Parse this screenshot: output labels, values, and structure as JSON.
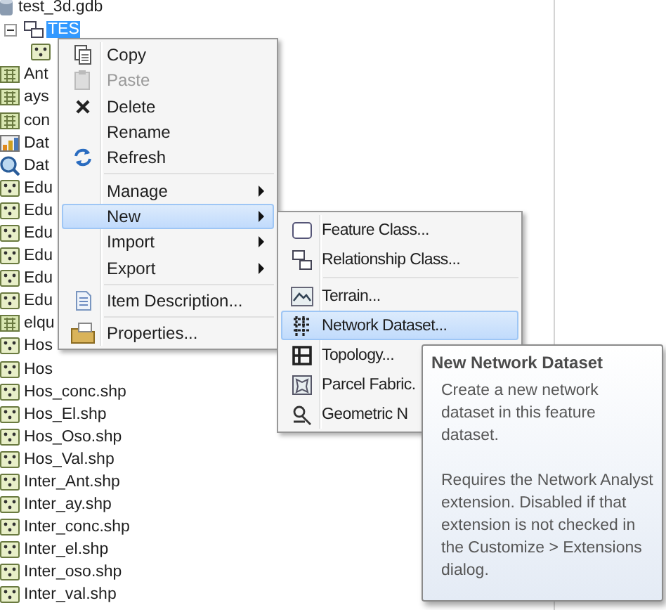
{
  "tree": {
    "items": [
      {
        "label": "test_3d.gdb",
        "kind": "database",
        "selected": false
      },
      {
        "label": "TES",
        "kind": "dataset",
        "selected": true,
        "expanded": true,
        "children": [
          {
            "kind": "point"
          }
        ]
      },
      {
        "label": "Ant",
        "kind": "raster",
        "selected": false
      },
      {
        "label": "ays",
        "kind": "raster",
        "selected": false
      },
      {
        "label": "con",
        "kind": "raster",
        "selected": false
      },
      {
        "label": "Dat",
        "kind": "chart",
        "selected": false
      },
      {
        "label": "Dat",
        "kind": "query",
        "selected": false
      },
      {
        "label": "Edu",
        "kind": "point",
        "selected": false
      },
      {
        "label": "Edu",
        "kind": "point",
        "selected": false
      },
      {
        "label": "Edu",
        "kind": "point",
        "selected": false
      },
      {
        "label": "Edu",
        "kind": "point",
        "selected": false
      },
      {
        "label": "Edu",
        "kind": "point",
        "selected": false
      },
      {
        "label": "Edu",
        "kind": "point",
        "selected": false
      },
      {
        "label": "elqu",
        "kind": "raster",
        "selected": false
      },
      {
        "label": "Hos",
        "kind": "point",
        "selected": false
      },
      {
        "label": "Hos",
        "kind": "point",
        "selected": false
      },
      {
        "label": "Hos_conc.shp",
        "kind": "point",
        "selected": false
      },
      {
        "label": "Hos_El.shp",
        "kind": "point",
        "selected": false
      },
      {
        "label": "Hos_Oso.shp",
        "kind": "point",
        "selected": false
      },
      {
        "label": "Hos_Val.shp",
        "kind": "point",
        "selected": false
      },
      {
        "label": "Inter_Ant.shp",
        "kind": "point",
        "selected": false
      },
      {
        "label": "Inter_ay.shp",
        "kind": "point",
        "selected": false
      },
      {
        "label": "Inter_conc.shp",
        "kind": "point",
        "selected": false
      },
      {
        "label": "Inter_el.shp",
        "kind": "point",
        "selected": false
      },
      {
        "label": "Inter_oso.shp",
        "kind": "point",
        "selected": false
      },
      {
        "label": "Inter_val.shp",
        "kind": "point",
        "selected": false
      }
    ]
  },
  "context_menu": {
    "groups": [
      [
        {
          "label": "Copy",
          "disabled": false,
          "selected": false,
          "submenu": false
        },
        {
          "label": "Paste",
          "disabled": true,
          "selected": false,
          "submenu": false
        },
        {
          "label": "Delete",
          "disabled": false,
          "selected": false,
          "submenu": false
        },
        {
          "label": "Rename",
          "disabled": false,
          "selected": false,
          "submenu": false
        },
        {
          "label": "Refresh",
          "disabled": false,
          "selected": false,
          "submenu": false
        }
      ],
      [
        {
          "label": "Manage",
          "disabled": false,
          "selected": false,
          "submenu": true
        },
        {
          "label": "New",
          "disabled": false,
          "selected": true,
          "submenu": true
        },
        {
          "label": "Import",
          "disabled": false,
          "selected": false,
          "submenu": true
        },
        {
          "label": "Export",
          "disabled": false,
          "selected": false,
          "submenu": true
        }
      ],
      [
        {
          "label": "Item Description...",
          "disabled": false,
          "selected": false,
          "submenu": false
        }
      ],
      [
        {
          "label": "Properties...",
          "disabled": false,
          "selected": false,
          "submenu": false
        }
      ]
    ]
  },
  "new_submenu": {
    "groups": [
      [
        {
          "label": "Feature Class...",
          "disabled": false,
          "selected": false,
          "submenu": false
        },
        {
          "label": "Relationship Class...",
          "disabled": false,
          "selected": false,
          "submenu": false
        }
      ],
      [
        {
          "label": "Terrain...",
          "disabled": false,
          "selected": false,
          "submenu": false
        },
        {
          "label": "Network Dataset...",
          "disabled": false,
          "selected": true,
          "submenu": false
        },
        {
          "label": "Topology...",
          "disabled": false,
          "selected": false,
          "submenu": false
        },
        {
          "label": "Parcel Fabric.",
          "disabled": false,
          "selected": false,
          "submenu": false
        },
        {
          "label": "Geometric N",
          "disabled": false,
          "selected": false,
          "submenu": false
        }
      ]
    ]
  },
  "tooltip": {
    "title": "New Network Dataset",
    "paragraphs": [
      "Create a new network dataset in this feature dataset.",
      "Requires the Network Analyst extension. Disabled if that extension is not checked in the Customize > Extensions dialog."
    ]
  }
}
